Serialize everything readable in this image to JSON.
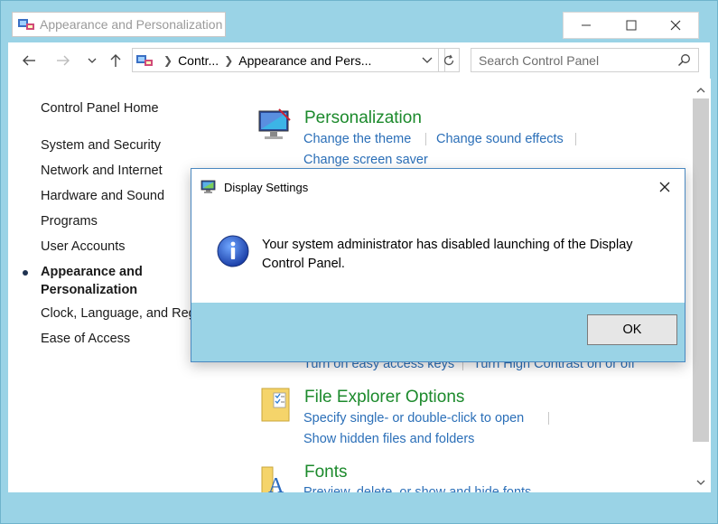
{
  "window": {
    "title": "Appearance and Personalization",
    "controls": {
      "minimize": "minimize",
      "maximize": "maximize",
      "close": "close"
    }
  },
  "address": {
    "crumbs": [
      "Contr...",
      "Appearance and Pers..."
    ],
    "search_placeholder": "Search Control Panel"
  },
  "sidebar": {
    "items": [
      "Control Panel Home",
      "System and Security",
      "Network and Internet",
      "Hardware and Sound",
      "Programs",
      "User Accounts",
      "Appearance and",
      "Personalization",
      "Clock, Language, and Region",
      "Ease of Access"
    ],
    "active_index": 6
  },
  "categories": {
    "personalization": {
      "title": "Personalization",
      "links": [
        "Change the theme",
        "Change sound effects",
        "Change screen saver"
      ]
    },
    "ease_of_access": {
      "links": [
        "Turn on easy access keys",
        "Turn High Contrast on or off"
      ]
    },
    "file_explorer": {
      "title": "File Explorer Options",
      "links": [
        "Specify single- or double-click to open",
        "Show hidden files and folders"
      ]
    },
    "fonts": {
      "title": "Fonts",
      "links": [
        "Preview, delete, or show and hide fonts"
      ]
    }
  },
  "dialog": {
    "title": "Display Settings",
    "message": "Your system administrator has disabled launching of the Display Control Panel.",
    "ok_label": "OK"
  },
  "colors": {
    "frame": "#9ad3e6",
    "link": "#2b6fb8",
    "category_title": "#1c8a2c"
  }
}
